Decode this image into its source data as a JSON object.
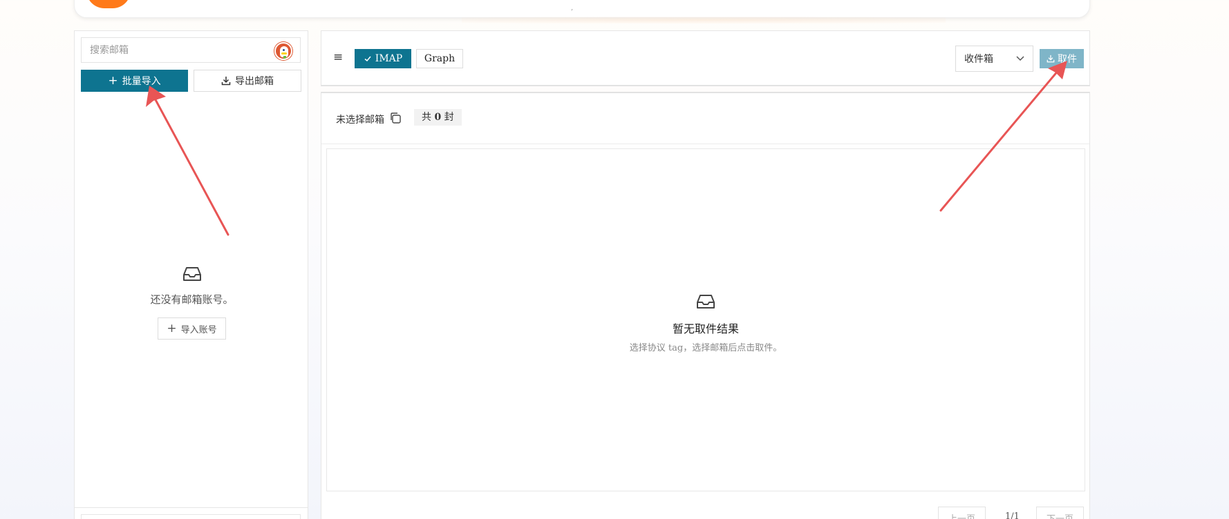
{
  "sidebar": {
    "search_placeholder": "搜索邮箱",
    "batch_import_label": "批量导入",
    "export_label": "导出邮箱",
    "empty_message": "还没有邮箱账号。",
    "import_account_label": "导入账号"
  },
  "toolbar": {
    "tab_imap": "IMAP",
    "tab_graph": "Graph",
    "folder_selected": "收件箱",
    "fetch_label": "取件"
  },
  "main": {
    "mailbox_label": "未选择邮箱",
    "count_prefix": "共",
    "count_value": "0",
    "count_suffix": "封",
    "empty_title": "暂无取件结果",
    "empty_subtitle": "选择协议 tag，选择邮箱后点击取件。"
  },
  "pagination": {
    "prev_label": "上一页",
    "page_indicator": "1/1",
    "next_label": "下一页"
  },
  "colors": {
    "accent": "#0e7490",
    "fetch_disabled": "#7fb5c8",
    "arrow": "#e85555"
  }
}
